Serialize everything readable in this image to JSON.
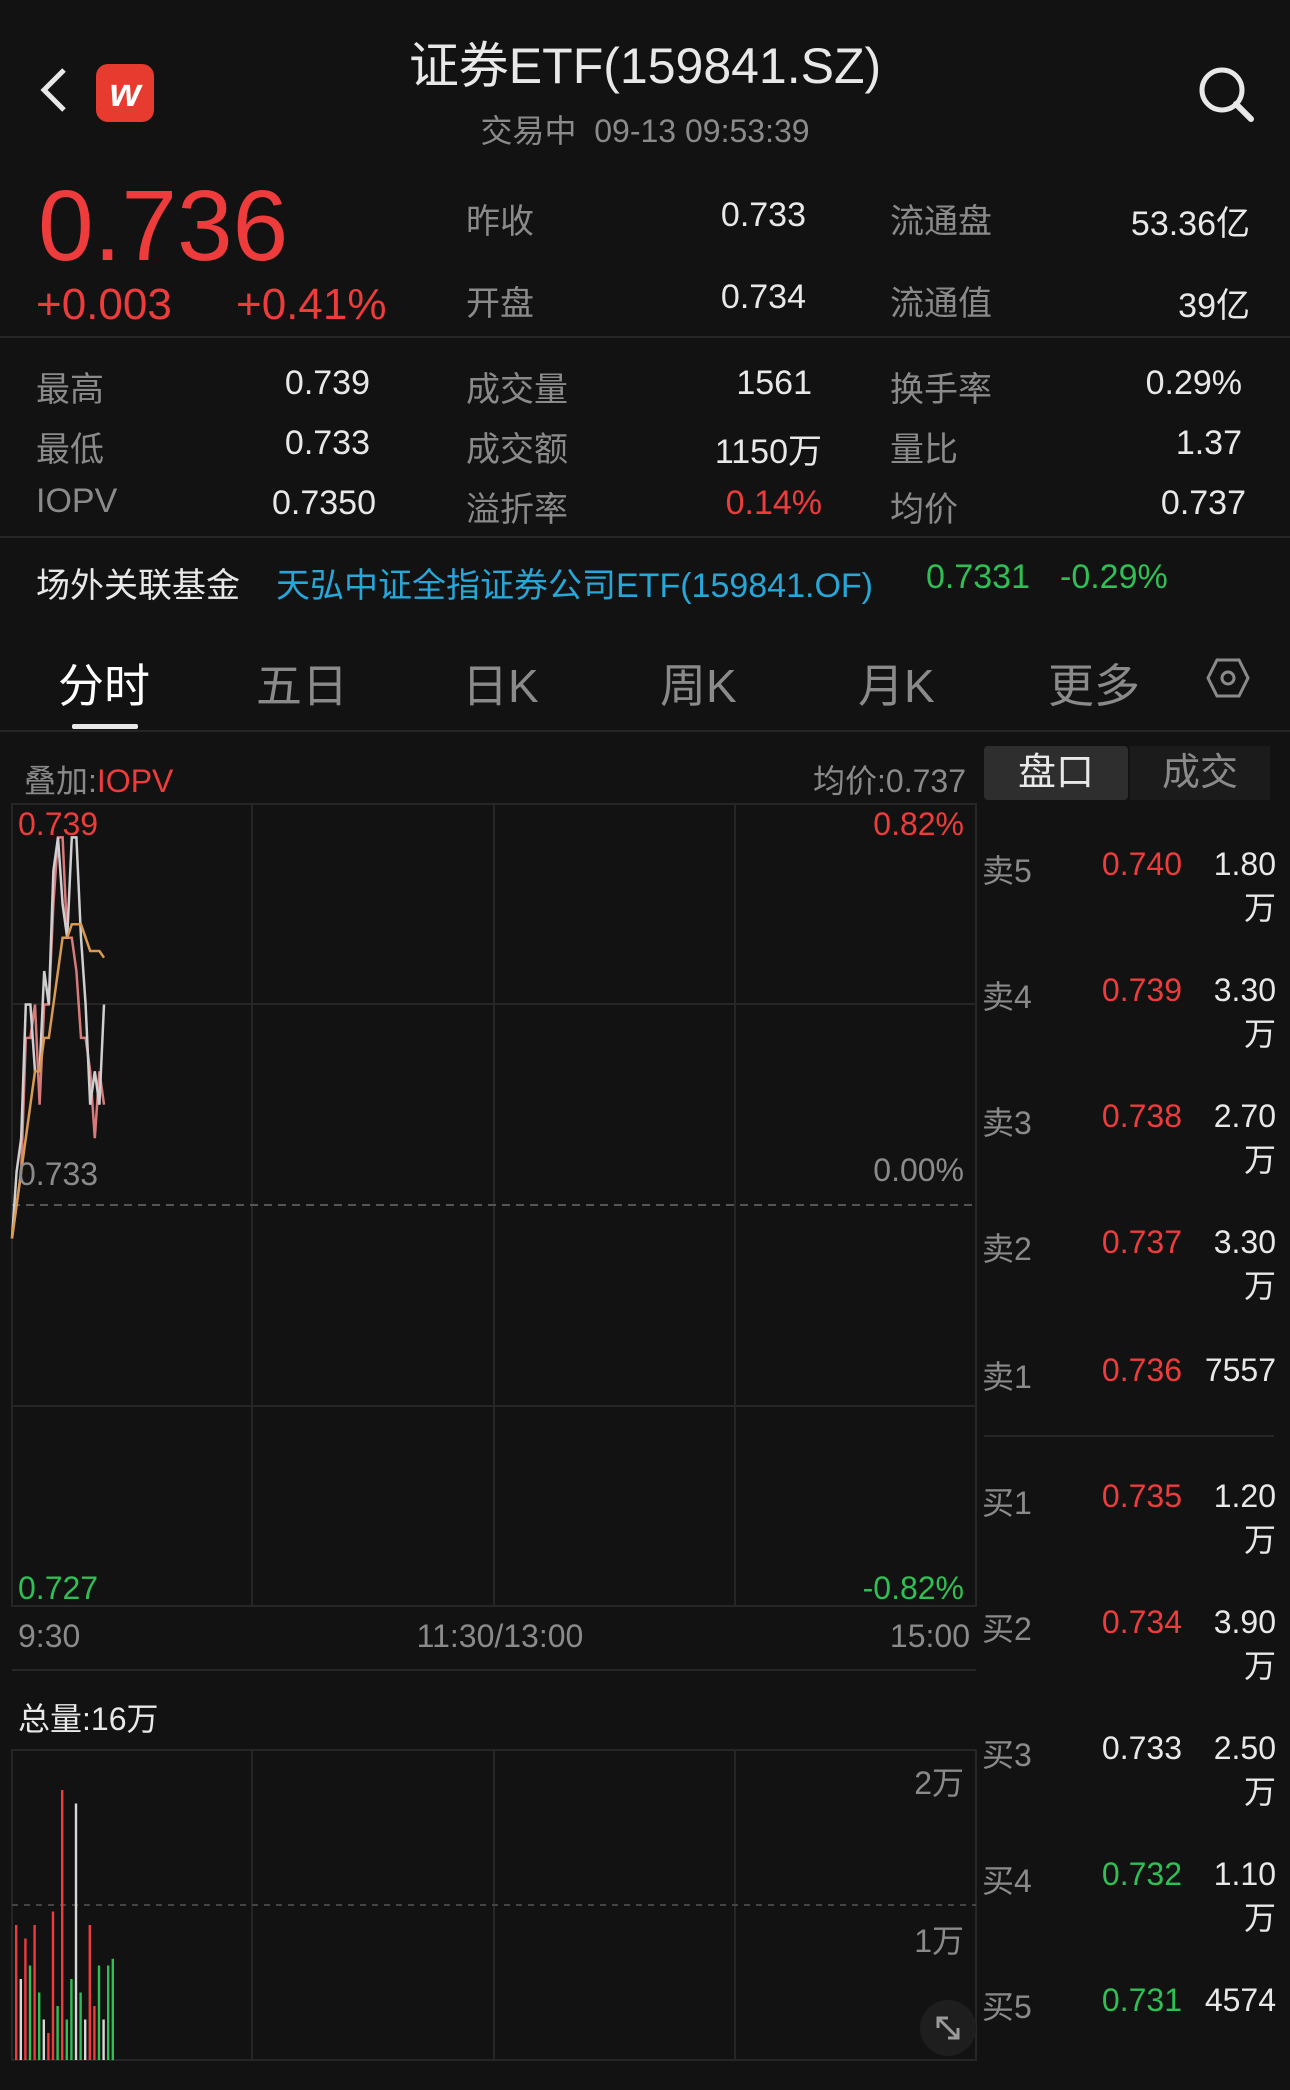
{
  "header": {
    "title": "证券ETF(159841.SZ)",
    "status": "交易中",
    "timestamp": "09-13 09:53:39",
    "logo_letter": "w",
    "logo_color": "#e63b2e"
  },
  "quote": {
    "price": "0.736",
    "change": "+0.003",
    "change_pct": "+0.41%"
  },
  "stats_top": [
    {
      "label": "昨收",
      "value": "0.733"
    },
    {
      "label": "流通盘",
      "value": "53.36亿"
    },
    {
      "label": "开盘",
      "value": "0.734"
    },
    {
      "label": "流通值",
      "value": "39亿"
    }
  ],
  "stats_grid": [
    {
      "label": "最高",
      "value": "0.739"
    },
    {
      "label": "成交量",
      "value": "1561"
    },
    {
      "label": "换手率",
      "value": "0.29%"
    },
    {
      "label": "最低",
      "value": "0.733"
    },
    {
      "label": "成交额",
      "value": "1150万"
    },
    {
      "label": "量比",
      "value": "1.37"
    },
    {
      "label": "IOPV",
      "value": "0.7350"
    },
    {
      "label": "溢折率",
      "value": "0.14%"
    },
    {
      "label": "均价",
      "value": "0.737"
    }
  ],
  "related_fund": {
    "label": "场外关联基金",
    "name": "天弘中证全指证券公司ETF(159841.OF)",
    "price": "0.7331",
    "change": "-0.29%"
  },
  "tabs": [
    "分时",
    "五日",
    "日K",
    "周K",
    "月K",
    "更多"
  ],
  "chart": {
    "overlay_prefix": "叠加:",
    "overlay_name": "IOPV",
    "avg_label": "均价:0.737",
    "y_top": "0.739",
    "y_mid": "0.733",
    "y_bottom": "0.727",
    "pct_top": "0.82%",
    "pct_mid": "0.00%",
    "pct_bottom": "-0.82%",
    "time_start": "9:30",
    "time_mid": "11:30/13:00",
    "time_end": "15:00",
    "volume_total": "总量:16万",
    "vol_tick_high": "2万",
    "vol_tick_low": "1万"
  },
  "chart_data": {
    "type": "line",
    "ylim": [
      0.727,
      0.739
    ],
    "x_range_minutes": 240,
    "series": [
      {
        "name": "",
        "color": "#d97a7a",
        "values": [
          0.7325,
          0.733,
          0.7335,
          0.7355,
          0.7355,
          0.736,
          0.7345,
          0.736,
          0.736,
          0.7375,
          0.7385,
          0.7385,
          0.737,
          0.737,
          0.7365,
          0.7355,
          0.7355,
          0.735,
          0.734,
          0.735,
          0.7345
        ]
      },
      {
        "name": "IOPV",
        "color": "#cfcfcf",
        "values": [
          0.7325,
          0.7335,
          0.734,
          0.736,
          0.736,
          0.735,
          0.735,
          0.7365,
          0.736,
          0.738,
          0.7385,
          0.7375,
          0.737,
          0.7385,
          0.7385,
          0.737,
          0.736,
          0.7345,
          0.735,
          0.7345,
          0.736
        ]
      },
      {
        "name": "均价",
        "color": "#d89a50",
        "values": [
          0.7325,
          0.733,
          0.7335,
          0.734,
          0.7345,
          0.735,
          0.735,
          0.7355,
          0.7355,
          0.736,
          0.7365,
          0.737,
          0.737,
          0.7372,
          0.7372,
          0.7372,
          0.737,
          0.7368,
          0.7368,
          0.7368,
          0.7367
        ]
      }
    ],
    "volume": {
      "ylim": [
        0,
        20000
      ],
      "bars": [
        {
          "v": 10000,
          "c": "red"
        },
        {
          "v": 6000,
          "c": "white"
        },
        {
          "v": 9000,
          "c": "red"
        },
        {
          "v": 7000,
          "c": "green"
        },
        {
          "v": 10000,
          "c": "red"
        },
        {
          "v": 5000,
          "c": "green"
        },
        {
          "v": 3000,
          "c": "white"
        },
        {
          "v": 2000,
          "c": "red"
        },
        {
          "v": 11000,
          "c": "red"
        },
        {
          "v": 4000,
          "c": "green"
        },
        {
          "v": 20000,
          "c": "red"
        },
        {
          "v": 3000,
          "c": "green"
        },
        {
          "v": 6000,
          "c": "green"
        },
        {
          "v": 19000,
          "c": "white"
        },
        {
          "v": 5000,
          "c": "green"
        },
        {
          "v": 3000,
          "c": "white"
        },
        {
          "v": 10000,
          "c": "red"
        },
        {
          "v": 4000,
          "c": "red"
        },
        {
          "v": 7000,
          "c": "green"
        },
        {
          "v": 3000,
          "c": "white"
        },
        {
          "v": 7000,
          "c": "green"
        },
        {
          "v": 7500,
          "c": "green"
        }
      ]
    }
  },
  "orderbook": {
    "seg_active": "盘口",
    "seg_other": "成交",
    "asks": [
      {
        "label": "卖5",
        "price": "0.740",
        "vol": "1.80万",
        "color": "red"
      },
      {
        "label": "卖4",
        "price": "0.739",
        "vol": "3.30万",
        "color": "red"
      },
      {
        "label": "卖3",
        "price": "0.738",
        "vol": "2.70万",
        "color": "red"
      },
      {
        "label": "卖2",
        "price": "0.737",
        "vol": "3.30万",
        "color": "red"
      },
      {
        "label": "卖1",
        "price": "0.736",
        "vol": "7557",
        "color": "red"
      }
    ],
    "bids": [
      {
        "label": "买1",
        "price": "0.735",
        "vol": "1.20万",
        "color": "red"
      },
      {
        "label": "买2",
        "price": "0.734",
        "vol": "3.90万",
        "color": "red"
      },
      {
        "label": "买3",
        "price": "0.733",
        "vol": "2.50万",
        "color": "white"
      },
      {
        "label": "买4",
        "price": "0.732",
        "vol": "1.10万",
        "color": "green"
      },
      {
        "label": "买5",
        "price": "0.731",
        "vol": "4574",
        "color": "green"
      }
    ]
  },
  "colors": {
    "up": "#ee3b3b",
    "down": "#2fbf55",
    "neutral": "#e8e8e8",
    "link": "#27a6d8"
  }
}
